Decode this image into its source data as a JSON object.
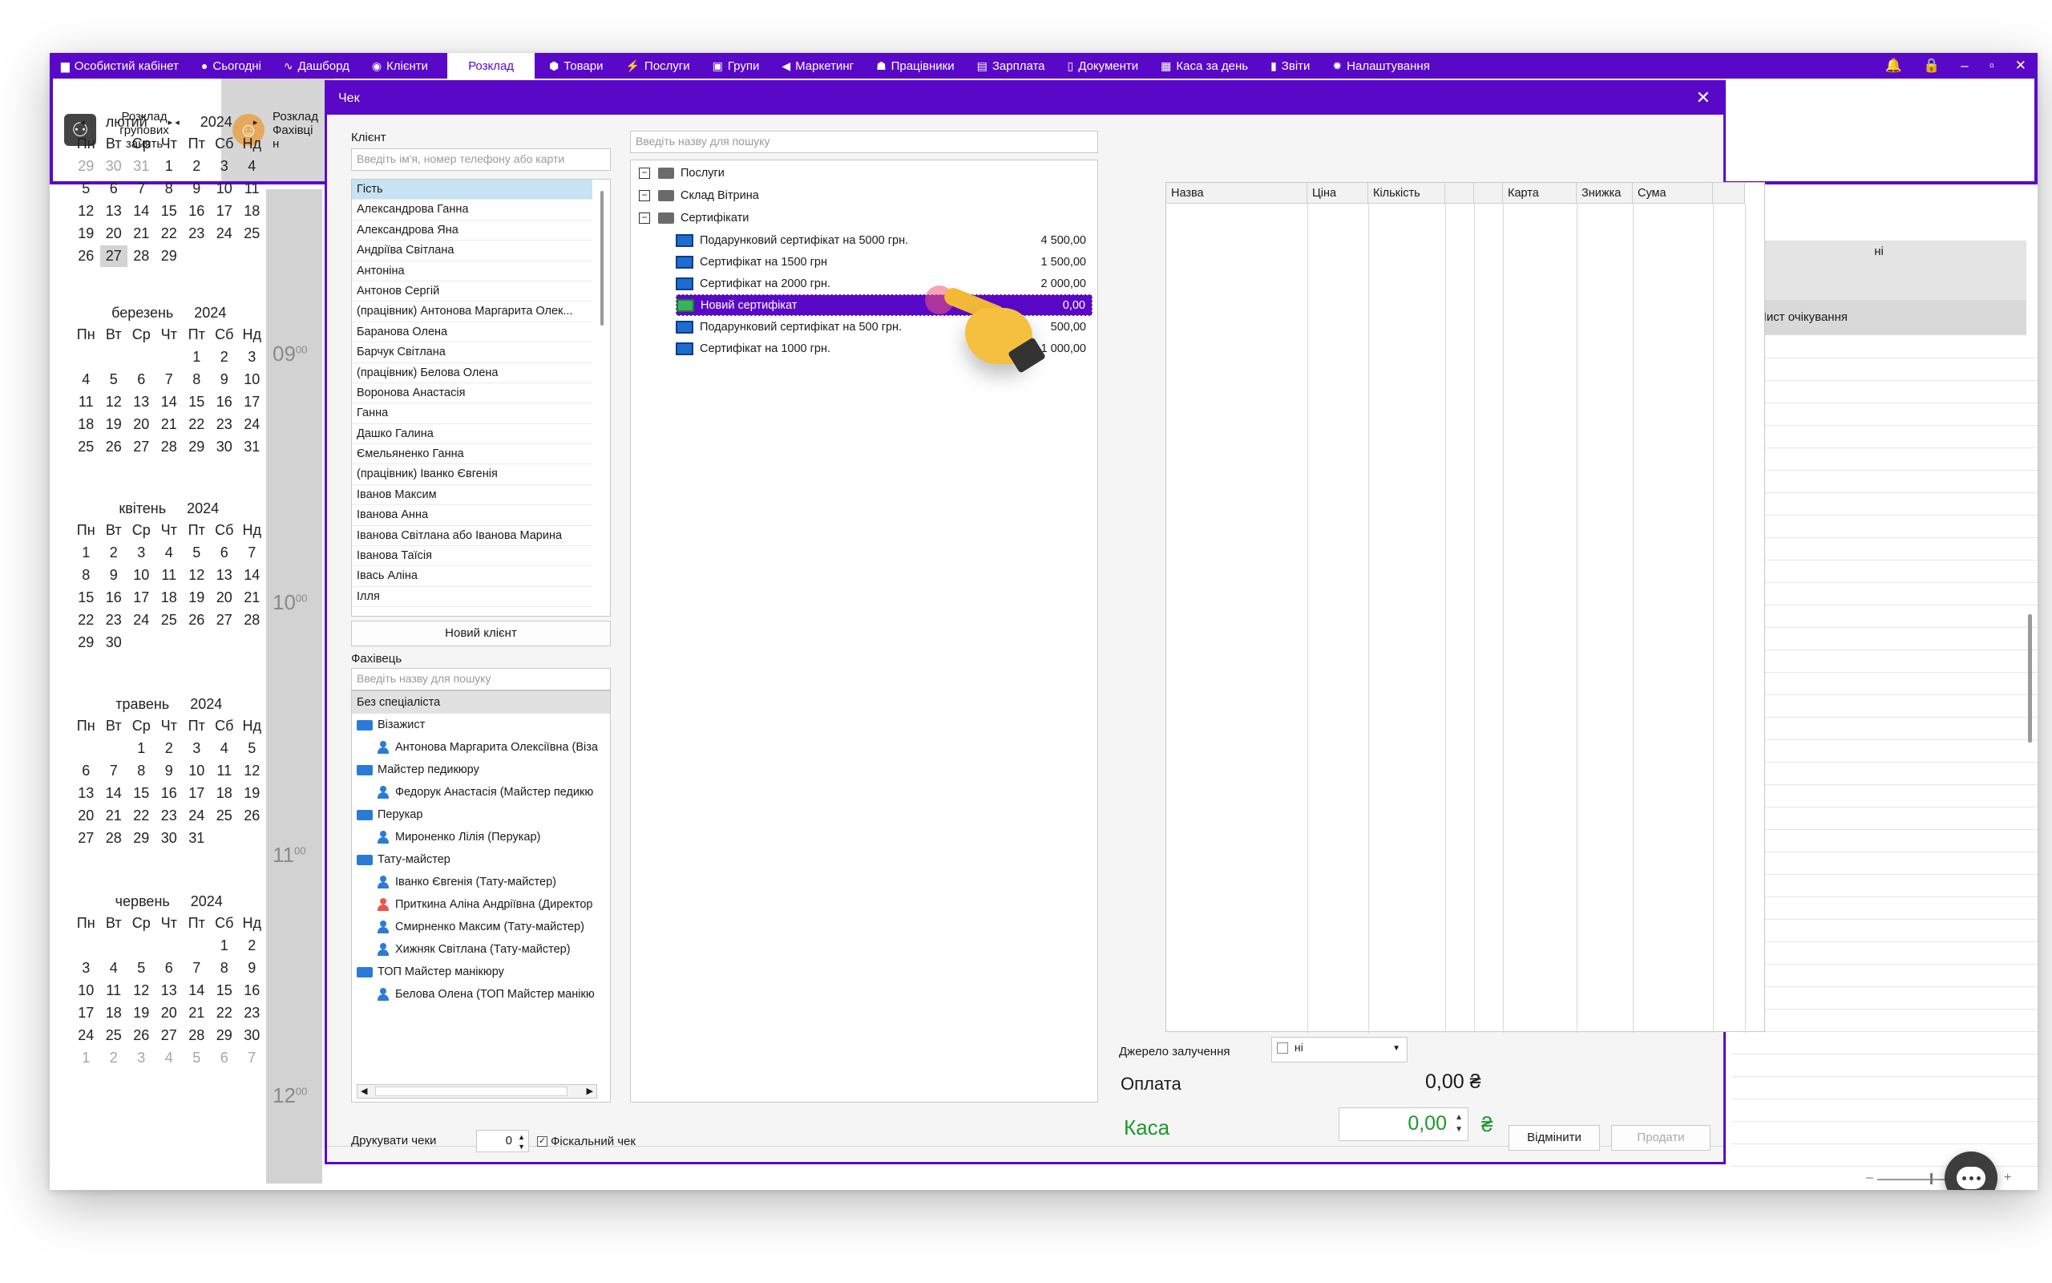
{
  "nav": {
    "items": [
      {
        "label": "Особистий кабінет",
        "icon": "briefcase-icon",
        "glyph": "▆"
      },
      {
        "label": "Сьогодні",
        "icon": "clock-icon",
        "glyph": "●"
      },
      {
        "label": "Дашборд",
        "icon": "pulse-icon",
        "glyph": "∿"
      },
      {
        "label": "Клієнти",
        "icon": "user-circle-icon",
        "glyph": "◉"
      },
      {
        "label": "Розклад",
        "icon": "",
        "glyph": "",
        "active": true
      },
      {
        "label": "Товари",
        "icon": "box-icon",
        "glyph": "⬢"
      },
      {
        "label": "Послуги",
        "icon": "bolt-icon",
        "glyph": "⚡"
      },
      {
        "label": "Групи",
        "icon": "image-icon",
        "glyph": "▣"
      },
      {
        "label": "Маркетинг",
        "icon": "megaphone-icon",
        "glyph": "◀"
      },
      {
        "label": "Працівники",
        "icon": "person-icon",
        "glyph": "☗"
      },
      {
        "label": "Зарплата",
        "icon": "money-icon",
        "glyph": "▤"
      },
      {
        "label": "Документи",
        "icon": "document-icon",
        "glyph": "▯"
      },
      {
        "label": "Каса за день",
        "icon": "calculator-icon",
        "glyph": "▦"
      },
      {
        "label": "Звіти",
        "icon": "bar-chart-icon",
        "glyph": "▮"
      },
      {
        "label": "Налаштування",
        "icon": "gear-icon",
        "glyph": "✹"
      }
    ],
    "window_controls": [
      "🔔",
      "🔒",
      "–",
      "▫",
      "✕"
    ]
  },
  "toolbar": {
    "group_schedule": "Розклад групових занять",
    "specialist_schedule": "Розклад Фахівці н"
  },
  "calendar": {
    "weekdays": [
      "Пн",
      "Вт",
      "Ср",
      "Чт",
      "Пт",
      "Сб",
      "Нд"
    ],
    "months": [
      {
        "name": "лютий",
        "year": "2024",
        "nav": true,
        "days": [
          "29",
          "30",
          "31",
          "1",
          "2",
          "3",
          "4",
          "5",
          "6",
          "7",
          "8",
          "9",
          "10",
          "11",
          "12",
          "13",
          "14",
          "15",
          "16",
          "17",
          "18",
          "19",
          "20",
          "21",
          "22",
          "23",
          "24",
          "25",
          "26",
          "27",
          "28",
          "29",
          "",
          "",
          ""
        ],
        "dim_lead": 3,
        "selected": "27"
      },
      {
        "name": "березень",
        "year": "2024",
        "days": [
          "",
          "",
          "",
          "",
          "1",
          "2",
          "3",
          "4",
          "5",
          "6",
          "7",
          "8",
          "9",
          "10",
          "11",
          "12",
          "13",
          "14",
          "15",
          "16",
          "17",
          "18",
          "19",
          "20",
          "21",
          "22",
          "23",
          "24",
          "25",
          "26",
          "27",
          "28",
          "29",
          "30",
          "31"
        ]
      },
      {
        "name": "квітень",
        "year": "2024",
        "days": [
          "1",
          "2",
          "3",
          "4",
          "5",
          "6",
          "7",
          "8",
          "9",
          "10",
          "11",
          "12",
          "13",
          "14",
          "15",
          "16",
          "17",
          "18",
          "19",
          "20",
          "21",
          "22",
          "23",
          "24",
          "25",
          "26",
          "27",
          "28",
          "29",
          "30"
        ]
      },
      {
        "name": "травень",
        "year": "2024",
        "days": [
          "",
          "",
          "1",
          "2",
          "3",
          "4",
          "5",
          "6",
          "7",
          "8",
          "9",
          "10",
          "11",
          "12",
          "13",
          "14",
          "15",
          "16",
          "17",
          "18",
          "19",
          "20",
          "21",
          "22",
          "23",
          "24",
          "25",
          "26",
          "27",
          "28",
          "29",
          "30",
          "31"
        ]
      },
      {
        "name": "червень",
        "year": "2024",
        "days": [
          "",
          "",
          "",
          "",
          "",
          "1",
          "2",
          "3",
          "4",
          "5",
          "6",
          "7",
          "8",
          "9",
          "10",
          "11",
          "12",
          "13",
          "14",
          "15",
          "16",
          "17",
          "18",
          "19",
          "20",
          "21",
          "22",
          "23",
          "24",
          "25",
          "26",
          "27",
          "28",
          "29",
          "30",
          "1",
          "2",
          "3",
          "4",
          "5",
          "6",
          "7"
        ],
        "dim_tail": 7
      }
    ]
  },
  "time_labels": [
    {
      "h": "09",
      "m": "00"
    },
    {
      "h": "10",
      "m": "00"
    },
    {
      "h": "11",
      "m": "00"
    },
    {
      "h": "12",
      "m": "00"
    }
  ],
  "right_panel": {
    "column_header": "ні",
    "waitlist": "Лист очікування"
  },
  "dialog": {
    "title": "Чек",
    "client_label": "Клієнт",
    "client_search_placeholder": "Введіть ім'я, номер телефону або карти",
    "clients": [
      "Гість",
      "Александрова Ганна",
      "Александрова Яна",
      "Андріїва Світлана",
      "Антоніна",
      "Антонов Сергій",
      "(працівник) Антонова Маргарита Олек...",
      "Баранова Олена",
      "Барчук Світлана",
      "(працівник) Белова Олена",
      "Воронова Анастасія",
      "Ганна",
      "Дашко Галина",
      "Ємельяненко Ганна",
      "(працівник) Іванко Євгенія",
      "Іванов Максим",
      "Іванова Анна",
      "Іванова Світлана або Іванова Марина",
      "Іванова Таїсія",
      "Івась Аліна",
      "Ілля"
    ],
    "new_client_button": "Новий клієнт",
    "specialist_label": "Фахівець",
    "specialist_search_placeholder": "Введіть назву для пошуку",
    "no_specialist": "Без спеціаліста",
    "specialists": [
      {
        "type": "group",
        "label": "Візажист"
      },
      {
        "type": "person",
        "label": "Антонова Маргарита Олексіївна (Віза"
      },
      {
        "type": "group",
        "label": "Майстер педикюру"
      },
      {
        "type": "person",
        "label": "Федорук Анастасія (Майстер педикю"
      },
      {
        "type": "group",
        "label": "Перукар"
      },
      {
        "type": "person",
        "label": "Мироненко Лілія (Перукар)"
      },
      {
        "type": "group",
        "label": "Тату-майстер"
      },
      {
        "type": "person",
        "label": "Іванко Євгенія (Тату-майстер)"
      },
      {
        "type": "person-red",
        "label": "Приткина Аліна Андріївна (Директор"
      },
      {
        "type": "person",
        "label": "Смирненко Максим (Тату-майстер)"
      },
      {
        "type": "person",
        "label": "Хижняк Світлана (Тату-майстер)"
      },
      {
        "type": "group",
        "label": "ТОП Майстер манікюру"
      },
      {
        "type": "person",
        "label": "Белова Олена (ТОП Майстер манікю"
      }
    ],
    "product_search_placeholder": "Введіть назву для пошуку",
    "tree": {
      "groups": [
        "Послуги",
        "Склад Вітрина",
        "Сертифікати"
      ],
      "items": [
        {
          "name": "Подарунковий сертифікат на 5000 грн.",
          "price": "4 500,00"
        },
        {
          "name": "Сертифікат на 1500 грн",
          "price": "1 500,00"
        },
        {
          "name": "Сертифікат на 2000 грн.",
          "price": "2 000,00"
        },
        {
          "name": "Новий сертифікат",
          "price": "0,00",
          "selected": true,
          "new": true
        },
        {
          "name": "Подарунковий сертифікат на 500 грн.",
          "price": "500,00"
        },
        {
          "name": "Сертифікат на 1000 грн.",
          "price": "1 000,00"
        }
      ]
    },
    "grid_headers": [
      "Назва",
      "Ціна",
      "Кількість",
      "",
      "",
      "Карта",
      "Знижка",
      "Сума",
      ""
    ],
    "source_label": "Джерело залучення",
    "source_value": "ні",
    "payment_label": "Оплата",
    "payment_value": "0,00 ₴",
    "cash_label": "Каса",
    "cash_value": "0,00",
    "cash_currency": "₴",
    "print_label": "Друкувати чеки",
    "print_count": "0",
    "fiscal_label": "Фіскальний чек",
    "cancel_button": "Відмінити",
    "sell_button": "Продати"
  },
  "colors": {
    "brand": "#5a08c8",
    "selection": "#5a08c8",
    "cash_green": "#1a9a2a",
    "client_selected": "#c7e3f3"
  }
}
